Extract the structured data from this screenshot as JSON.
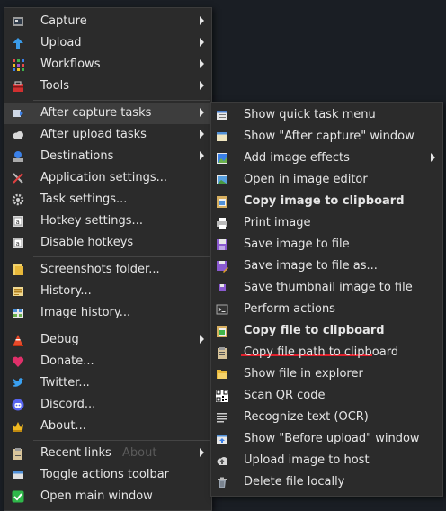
{
  "main_menu": {
    "items": [
      {
        "label": "Capture",
        "icon": "camera-icon"
      },
      {
        "label": "Upload",
        "icon": "upload-arrow-icon"
      },
      {
        "label": "Workflows",
        "icon": "workflows-grid-icon"
      },
      {
        "label": "Tools",
        "icon": "toolbox-icon"
      },
      {
        "label": "After capture tasks",
        "icon": "after-capture-icon"
      },
      {
        "label": "After upload tasks",
        "icon": "cloud-icon"
      },
      {
        "label": "Destinations",
        "icon": "destinations-icon"
      },
      {
        "label": "Application settings...",
        "icon": "wrench-screwdriver-icon"
      },
      {
        "label": "Task settings...",
        "icon": "gear-icon"
      },
      {
        "label": "Hotkey settings...",
        "icon": "keyboard-icon"
      },
      {
        "label": "Disable hotkeys",
        "icon": "keyboard-disable-icon"
      },
      {
        "label": "Screenshots folder...",
        "icon": "folder-icon"
      },
      {
        "label": "History...",
        "icon": "history-icon"
      },
      {
        "label": "Image history...",
        "icon": "image-history-icon"
      },
      {
        "label": "Debug",
        "icon": "traffic-cone-icon"
      },
      {
        "label": "Donate...",
        "icon": "heart-icon"
      },
      {
        "label": "Twitter...",
        "icon": "twitter-bird-icon"
      },
      {
        "label": "Discord...",
        "icon": "discord-icon"
      },
      {
        "label": "About...",
        "icon": "crown-icon"
      },
      {
        "label": "Recent links",
        "icon": "clipboard-icon"
      },
      {
        "label": "Toggle actions toolbar",
        "icon": "toolbar-icon"
      },
      {
        "label": "Open main window",
        "icon": "check-icon"
      }
    ],
    "ghost_text": "About"
  },
  "submenu": {
    "items": [
      {
        "label": "Show quick task menu",
        "icon": "quick-task-icon"
      },
      {
        "label": "Show \"After capture\" window",
        "icon": "window-icon"
      },
      {
        "label": "Add image effects",
        "icon": "image-effects-icon"
      },
      {
        "label": "Open in image editor",
        "icon": "image-editor-icon"
      },
      {
        "label": "Copy image to clipboard",
        "icon": "copy-image-icon"
      },
      {
        "label": "Print image",
        "icon": "printer-icon"
      },
      {
        "label": "Save image to file",
        "icon": "floppy-disk-icon"
      },
      {
        "label": "Save image to file as...",
        "icon": "floppy-disk-as-icon"
      },
      {
        "label": "Save thumbnail image to file",
        "icon": "thumbnail-disk-icon"
      },
      {
        "label": "Perform actions",
        "icon": "terminal-icon"
      },
      {
        "label": "Copy file to clipboard",
        "icon": "copy-file-icon"
      },
      {
        "label": "Copy file path to clipboard",
        "icon": "clipboard-path-icon"
      },
      {
        "label": "Show file in explorer",
        "icon": "folder-open-icon"
      },
      {
        "label": "Scan QR code",
        "icon": "qr-code-icon"
      },
      {
        "label": "Recognize text (OCR)",
        "icon": "ocr-text-icon"
      },
      {
        "label": "Show \"Before upload\" window",
        "icon": "before-upload-icon"
      },
      {
        "label": "Upload image to host",
        "icon": "cloud-upload-icon"
      },
      {
        "label": "Delete file locally",
        "icon": "trash-icon"
      }
    ]
  },
  "colors": {
    "background": "#1a1e24",
    "menu": "#2b2b2b",
    "highlight": "#3d3d3d",
    "underline": "#e0202c"
  }
}
